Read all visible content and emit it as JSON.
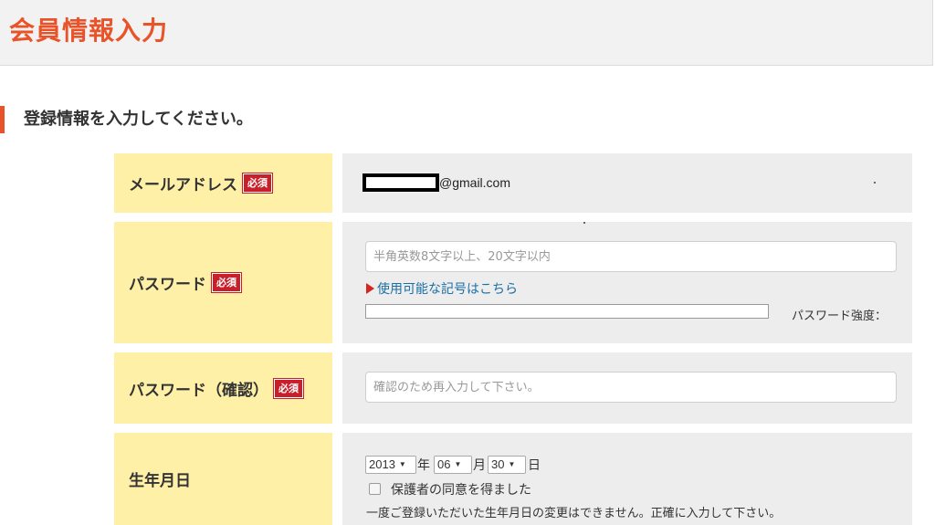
{
  "header": {
    "title": "会員情報入力"
  },
  "section": {
    "heading": "登録情報を入力してください。"
  },
  "required_label": "必須",
  "email_row": {
    "label": "メールアドレス",
    "value_domain": "@gmail.com"
  },
  "password_row": {
    "label": "パスワード",
    "placeholder": "半角英数8文字以上、20文字以内",
    "symbol_link": "使用可能な記号はこちら",
    "strength_label": "パスワード強度："
  },
  "password_confirm_row": {
    "label": "パスワード（確認）",
    "placeholder": "確認のため再入力して下さい。"
  },
  "birthdate_row": {
    "label": "生年月日",
    "year": "2013",
    "year_unit": "年",
    "month": "06",
    "month_unit": "月",
    "day": "30",
    "day_unit": "日",
    "guardian_consent": "保護者の同意を得ました",
    "note": "一度ご登録いただいた生年月日の変更はできません。正確に入力して下さい。"
  },
  "colors": {
    "accent": "#e8532a",
    "label_bg": "#fff0a8",
    "required_badge": "#c8202a",
    "link": "#1a6fa6"
  },
  "icons": {
    "select_caret": "chevron-down-icon",
    "link_marker": "triangle-right-icon"
  }
}
